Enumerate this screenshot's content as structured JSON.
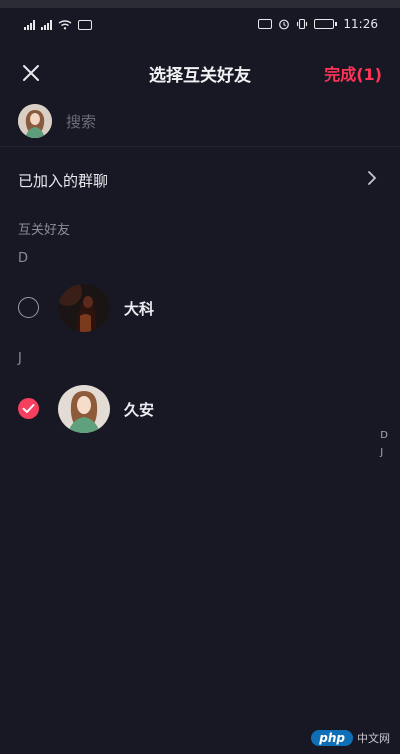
{
  "status_bar": {
    "time": "11:26",
    "battery": "80",
    "colors": {
      "icon": "#e7e7ea"
    }
  },
  "nav": {
    "close_icon": "close-icon",
    "title": "选择互关好友",
    "done_label": "完成(1)",
    "accent_color": "#ff3458"
  },
  "search": {
    "placeholder": "搜索"
  },
  "joined_groups": {
    "label": "已加入的群聊"
  },
  "friends_section": {
    "title": "互关好友",
    "groups": [
      {
        "letter": "D",
        "friends": [
          {
            "name": "大科",
            "selected": false
          }
        ]
      },
      {
        "letter": "J",
        "friends": [
          {
            "name": "久安",
            "selected": true
          }
        ]
      }
    ]
  },
  "index_bar": [
    "D",
    "J"
  ],
  "watermark": {
    "badge": "php",
    "text": "中文网"
  }
}
